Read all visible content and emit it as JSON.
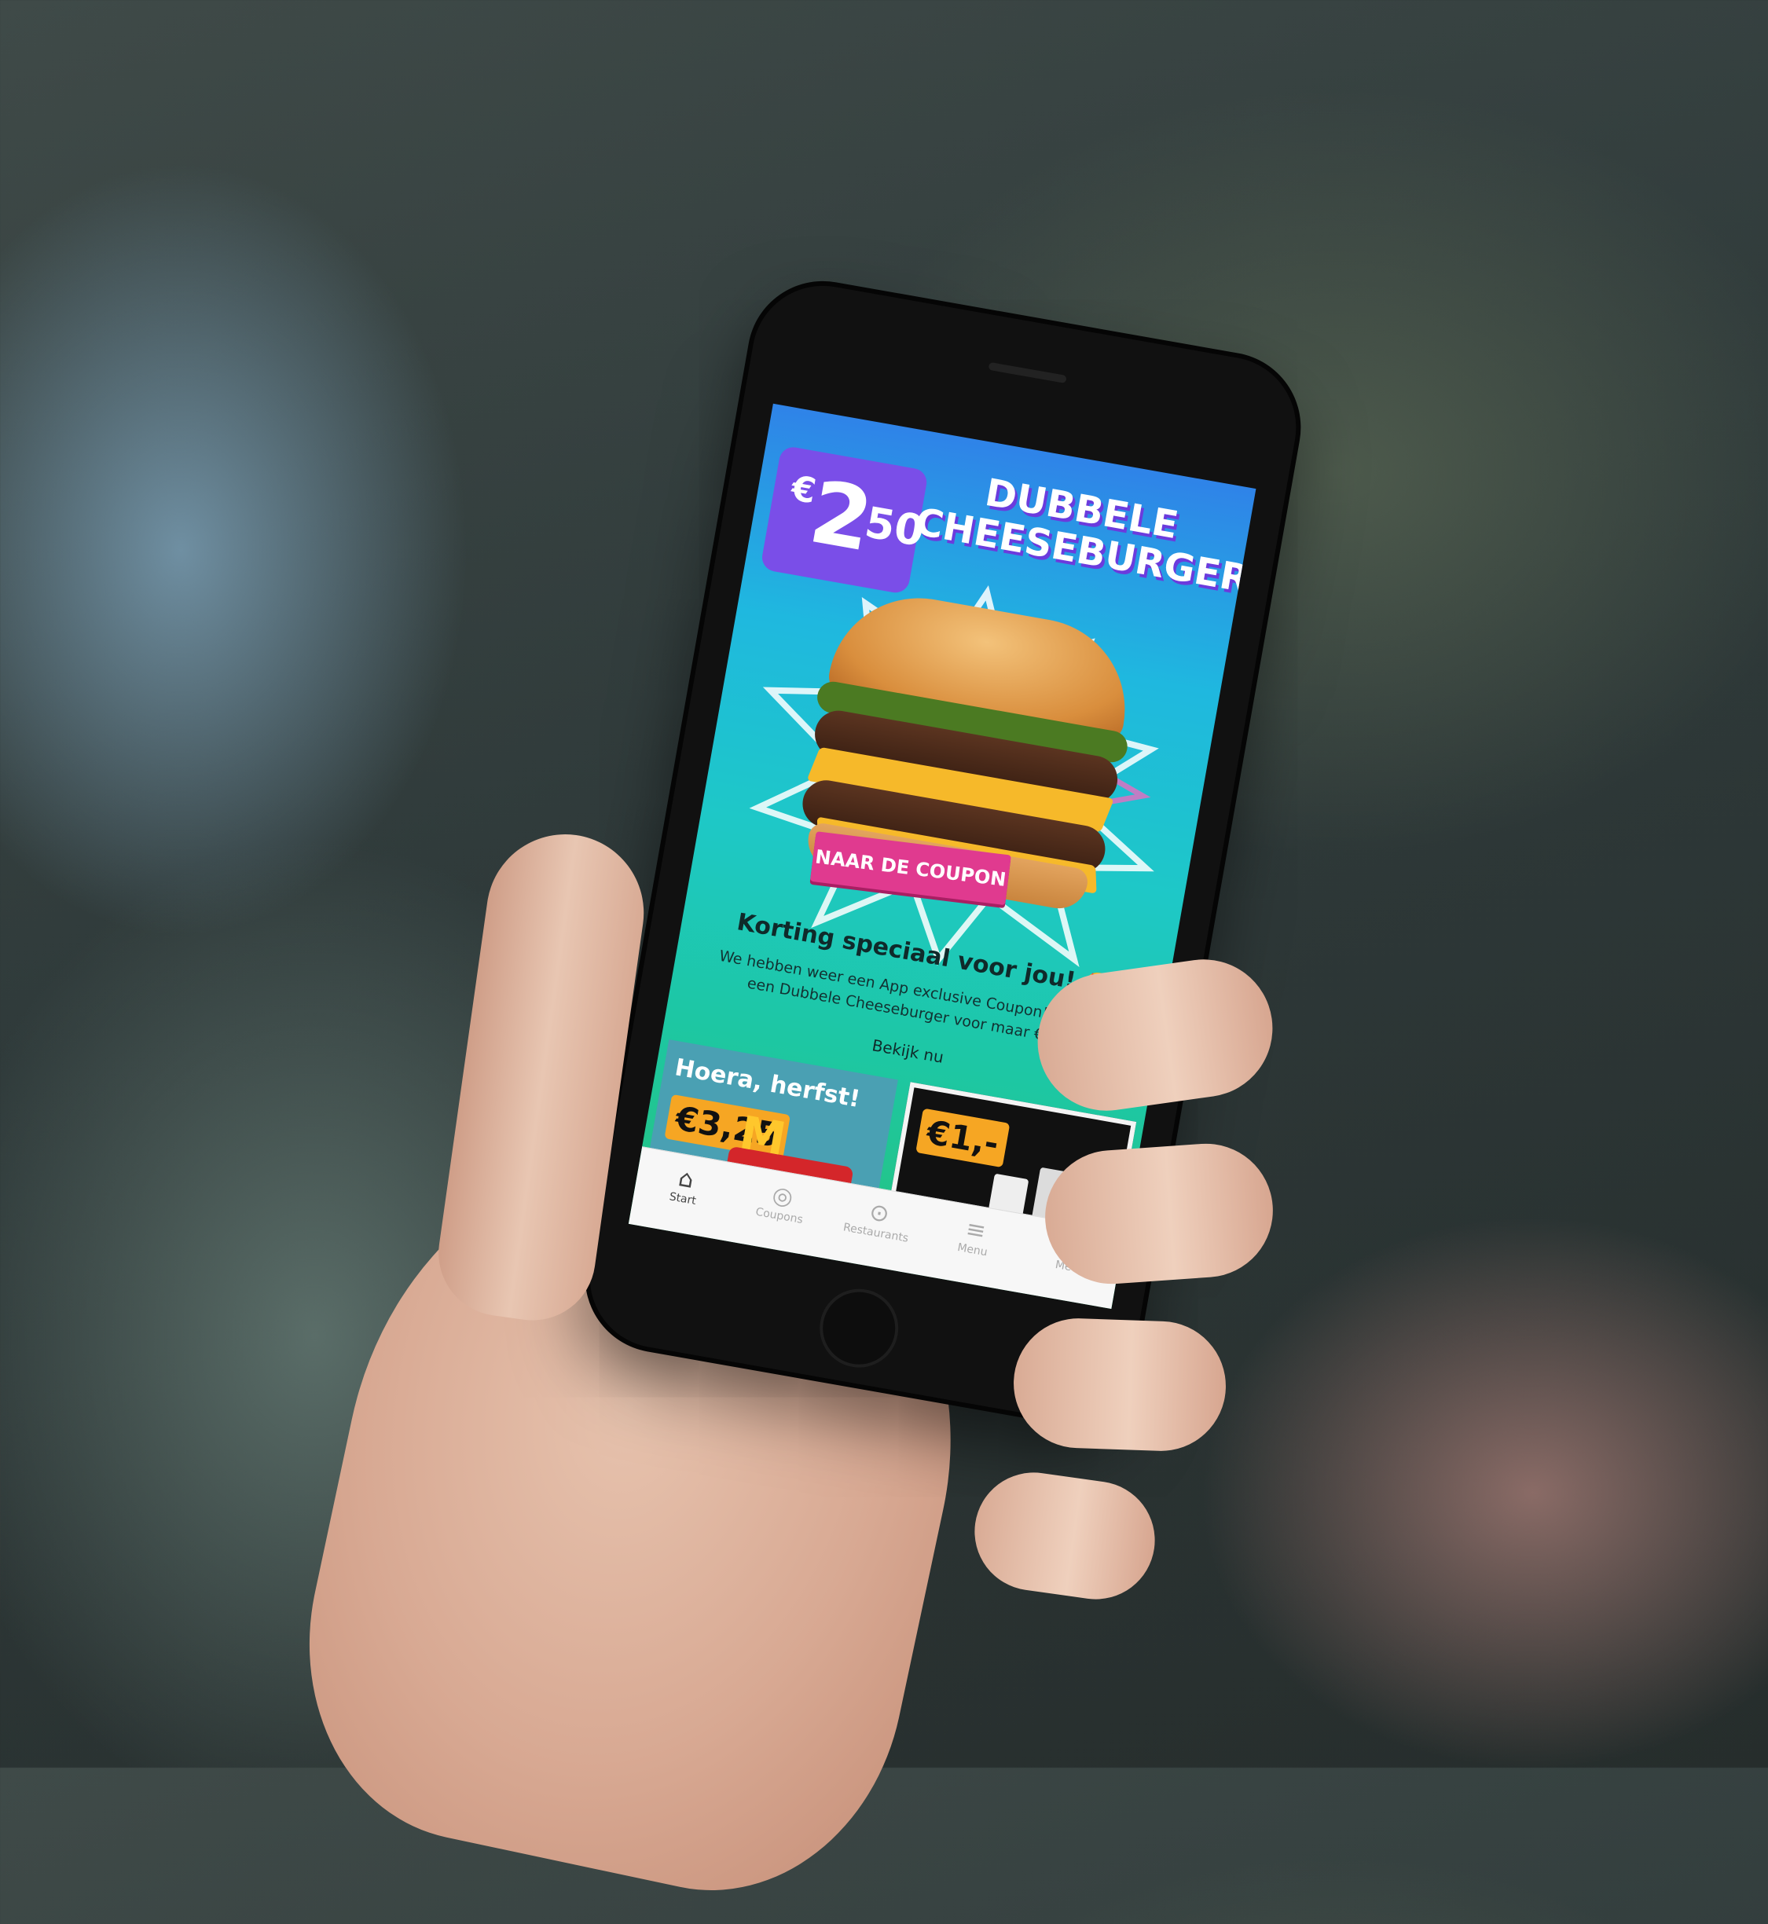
{
  "hero": {
    "price_currency": "€",
    "price_main": "2",
    "price_cents": "50",
    "title_line1": "DUBBELE",
    "title_line2": "CHEESEBURGER",
    "cta_label": "NAAR DE COUPON"
  },
  "promo": {
    "headline": "Korting speciaal voor jou! 🤩",
    "body": "We hebben weer een App exclusive Coupon! Scoor nu een Dubbele Cheeseburger voor maar €2,50!",
    "link_label": "Bekijk nu"
  },
  "tiles": [
    {
      "title": "Hoera, herfst!",
      "price": "€3,25"
    },
    {
      "title": "",
      "price": "€1,-"
    }
  ],
  "tabbar": {
    "items": [
      {
        "label": "Start",
        "icon": "home-icon",
        "active": true
      },
      {
        "label": "Coupons",
        "icon": "coupon-icon",
        "active": false
      },
      {
        "label": "Restaurants",
        "icon": "location-pin-icon",
        "active": false
      },
      {
        "label": "Menu",
        "icon": "burger-icon",
        "active": false
      },
      {
        "label": "Meer",
        "icon": "more-dots-icon",
        "active": false
      }
    ]
  },
  "colors": {
    "badge_purple": "#7a4ee8",
    "cta_pink": "#e03a8f",
    "price_orange": "#f6a623",
    "screen_top": "#2f83e8",
    "screen_bottom": "#26c37f"
  }
}
